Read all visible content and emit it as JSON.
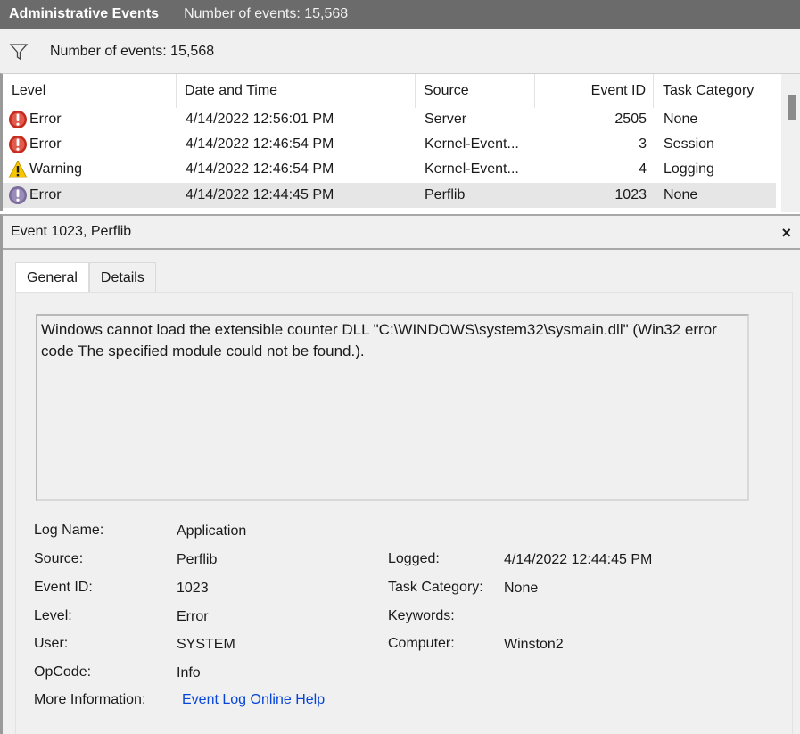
{
  "header": {
    "title": "Administrative Events",
    "event_count": "Number of events: 15,568"
  },
  "filter": {
    "icon": "funnel-icon",
    "label": "Number of events: 15,568"
  },
  "grid": {
    "columns": [
      "Level",
      "Date and Time",
      "Source",
      "Event ID",
      "Task Category"
    ],
    "rows": [
      {
        "level": "Error",
        "icon": "error-icon",
        "datetime": "4/14/2022 12:56:01 PM",
        "source": "Server",
        "event_id": "2505",
        "category": "None"
      },
      {
        "level": "Error",
        "icon": "error-icon",
        "datetime": "4/14/2022 12:46:54 PM",
        "source": "Kernel-Event...",
        "event_id": "3",
        "category": "Session"
      },
      {
        "level": "Warning",
        "icon": "warning-icon",
        "datetime": "4/14/2022 12:46:54 PM",
        "source": "Kernel-Event...",
        "event_id": "4",
        "category": "Logging"
      },
      {
        "level": "Error",
        "icon": "error-icon",
        "datetime": "4/14/2022 12:44:45 PM",
        "source": "Perflib",
        "event_id": "1023",
        "category": "None"
      }
    ]
  },
  "detail": {
    "title": "Event 1023, Perflib",
    "close": "×",
    "tabs": [
      "General",
      "Details"
    ],
    "description": "Windows cannot load the extensible counter DLL \"C:\\WINDOWS\\system32\\sysmain.dll\" (Win32 error code The specified module could not be found.).",
    "fields": {
      "log_name_label": "Log Name:",
      "log_name": "Application",
      "source_label": "Source:",
      "source": "Perflib",
      "event_id_label": "Event ID:",
      "event_id": "1023",
      "level_label": "Level:",
      "level": "Error",
      "user_label": "User:",
      "user": "SYSTEM",
      "opcode_label": "OpCode:",
      "opcode": "Info",
      "more_info_label": "More Information:",
      "more_info": "Event Log Online Help",
      "logged_label": "Logged:",
      "logged": "4/14/2022 12:44:45 PM",
      "task_category_label": "Task Category:",
      "task_category": "None",
      "keywords_label": "Keywords:",
      "keywords": "",
      "computer_label": "Computer:",
      "computer": "Winston2"
    }
  },
  "colors": {
    "titlebar": "#6b6b6b",
    "error": "#c42b1c",
    "warning": "#f7c600",
    "link": "#0645d6",
    "selected_row": "#e6e6e6"
  }
}
